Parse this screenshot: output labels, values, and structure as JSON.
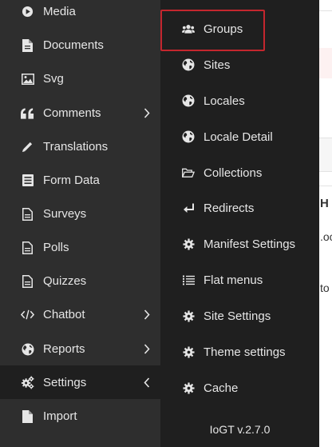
{
  "sidebar": {
    "items": [
      {
        "label": "Media",
        "icon": "play-circle-icon",
        "has_arrow": false
      },
      {
        "label": "Documents",
        "icon": "document-icon",
        "has_arrow": false
      },
      {
        "label": "Svg",
        "icon": "image-icon",
        "has_arrow": false
      },
      {
        "label": "Comments",
        "icon": "quote-icon",
        "has_arrow": true
      },
      {
        "label": "Translations",
        "icon": "pencil-icon",
        "has_arrow": false
      },
      {
        "label": "Form Data",
        "icon": "list-box-icon",
        "has_arrow": false
      },
      {
        "label": "Surveys",
        "icon": "document-lines-icon",
        "has_arrow": false
      },
      {
        "label": "Polls",
        "icon": "document-lines-icon",
        "has_arrow": false
      },
      {
        "label": "Quizzes",
        "icon": "document-lines-icon",
        "has_arrow": false
      },
      {
        "label": "Chatbot",
        "icon": "code-icon",
        "has_arrow": true
      },
      {
        "label": "Reports",
        "icon": "globe-icon",
        "has_arrow": true
      },
      {
        "label": "Settings",
        "icon": "cogs-icon",
        "has_arrow": true,
        "active": true
      },
      {
        "label": "Import",
        "icon": "document-icon",
        "has_arrow": false
      }
    ]
  },
  "submenu": {
    "items": [
      {
        "label": "Groups",
        "icon": "users-icon"
      },
      {
        "label": "Sites",
        "icon": "globe-icon"
      },
      {
        "label": "Locales",
        "icon": "globe-icon"
      },
      {
        "label": "Locale Detail",
        "icon": "globe-icon"
      },
      {
        "label": "Collections",
        "icon": "folder-open-icon"
      },
      {
        "label": "Redirects",
        "icon": "redirect-arrow-icon"
      },
      {
        "label": "Manifest Settings",
        "icon": "cog-icon"
      },
      {
        "label": "Flat menus",
        "icon": "list-icon"
      },
      {
        "label": "Site Settings",
        "icon": "cog-icon"
      },
      {
        "label": "Theme settings",
        "icon": "cog-icon"
      },
      {
        "label": "Cache",
        "icon": "cog-icon"
      }
    ],
    "version": "IoGT v.2.7.0",
    "highlight_color": "#c4262e"
  },
  "background_page": {
    "fragments": [
      "H",
      ".oc",
      "to"
    ]
  },
  "colors": {
    "sidebar_bg": "#2e2e2e",
    "submenu_bg": "#1f1f1f",
    "text": "#e6e6e6"
  }
}
